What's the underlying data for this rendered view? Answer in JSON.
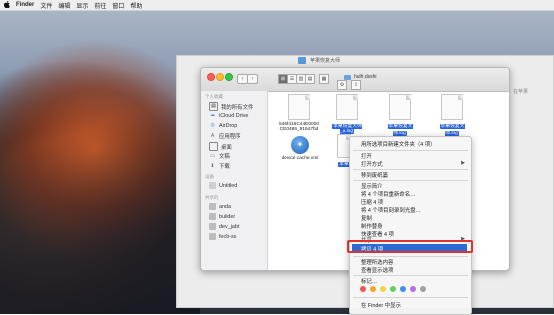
{
  "menubar": {
    "apple": "",
    "app": "Finder",
    "items": [
      "文件",
      "编辑",
      "显示",
      "前往",
      "窗口",
      "帮助"
    ]
  },
  "back_window": {
    "title": "苹果恢复大师",
    "side_label": "在苹果"
  },
  "finder": {
    "path_folder": "hulh.dsshi",
    "view_buttons": [
      "⊞",
      "☰",
      "▥",
      "▤"
    ],
    "sidebar": {
      "section_personal": "个人收藏",
      "items": [
        {
          "label": "我的所有文件",
          "icon": "all-files-icon"
        },
        {
          "label": "iCloud Drive",
          "icon": "cloud-icon"
        },
        {
          "label": "AirDrop",
          "icon": "airdrop-icon"
        },
        {
          "label": "应用程序",
          "icon": "applications-icon"
        },
        {
          "label": "桌面",
          "icon": "desktop-icon"
        },
        {
          "label": "文稿",
          "icon": "documents-icon"
        },
        {
          "label": "下载",
          "icon": "downloads-icon"
        }
      ],
      "section_devices": "设备",
      "devices": [
        {
          "label": "Untitled",
          "icon": "disk-icon"
        }
      ],
      "section_shared": "共享的",
      "shared": [
        {
          "label": "anda",
          "icon": "computer-icon"
        },
        {
          "label": "builder",
          "icon": "computer-icon"
        },
        {
          "label": "dev_jabt",
          "icon": "computer-icon"
        },
        {
          "label": "fecb-ss",
          "icon": "computer-icon"
        }
      ]
    },
    "files": [
      {
        "name": "546f416C44E0000 CE0486_91647bd",
        "selected": false
      },
      {
        "name": "苹果恢复大师_a.log",
        "selected": true
      },
      {
        "name": "苹果恢复大师.log",
        "selected": true
      },
      {
        "name": "苹果恢复大师.log",
        "selected": true
      },
      {
        "name": "device.cache.xml",
        "selected": false
      },
      {
        "name": "苹果",
        "selected": true
      }
    ]
  },
  "context_menu": {
    "items": [
      {
        "label": "用所选项目新建文件夹（4 项）",
        "submenu": false
      },
      {
        "label": "打开",
        "submenu": false
      },
      {
        "label": "打开方式",
        "submenu": true
      },
      {
        "label": "移到废纸篓",
        "submenu": false
      },
      {
        "label": "显示简介",
        "submenu": false
      },
      {
        "label": "将 4 个项目重新命名…",
        "submenu": false
      },
      {
        "label": "压缩 4 项",
        "submenu": false
      },
      {
        "label": "将 4 个项目刻录到光盘…",
        "submenu": false
      },
      {
        "label": "复制",
        "submenu": false
      },
      {
        "label": "制作替身",
        "submenu": false
      },
      {
        "label": "快速查看 4 项",
        "submenu": false
      },
      {
        "label": "共享",
        "submenu": true
      },
      {
        "label": "拷贝 4 项",
        "submenu": false,
        "highlighted": true
      },
      {
        "label": "整理所选内容",
        "submenu": false
      },
      {
        "label": "查看显示选项",
        "submenu": false
      },
      {
        "label": "标记…",
        "submenu": false
      },
      {
        "label": "在 Finder 中显示",
        "submenu": false
      }
    ],
    "tag_colors": [
      "#f0564e",
      "#f5a623",
      "#f3d33d",
      "#5fd35a",
      "#3f8ff2",
      "#b66fe0",
      "#a0a0a0"
    ]
  }
}
